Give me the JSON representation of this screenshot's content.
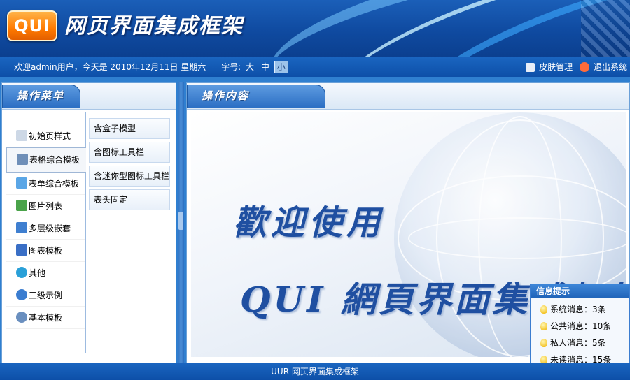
{
  "header": {
    "logo_text": "QUI",
    "title": "网页界面集成框架"
  },
  "statusbar": {
    "welcome": "欢迎admin用户，今天是 2010年12月11日 星期六",
    "font_size_label": "字号:",
    "font_sizes": [
      "大",
      "中",
      "小"
    ],
    "font_size_selected": "小",
    "skin_label": "皮肤管理",
    "logout_label": "退出系统"
  },
  "left_panel": {
    "title": "操作菜单",
    "menu": [
      {
        "label": "初始页样式",
        "icon": "tag-icon"
      },
      {
        "label": "表格综合模板",
        "icon": "table-icon",
        "active": true
      },
      {
        "label": "表单综合模板",
        "icon": "form-icon"
      },
      {
        "label": "图片列表",
        "icon": "image-icon"
      },
      {
        "label": "多层级嵌套",
        "icon": "pages-icon"
      },
      {
        "label": "图表模板",
        "icon": "chart-icon"
      },
      {
        "label": "其他",
        "icon": "globe-icon"
      },
      {
        "label": "三级示例",
        "icon": "info-icon"
      },
      {
        "label": "基本模板",
        "icon": "help-icon"
      }
    ],
    "submenu": [
      "含盒子模型",
      "含图标工具栏",
      "含迷你型图标工具栏",
      "表头固定"
    ]
  },
  "right_panel": {
    "title": "操作内容",
    "welcome_line1": "歡迎使用",
    "welcome_line2": "QUI 網頁界面集成框架"
  },
  "info_box": {
    "title": "信息提示",
    "items": [
      "系统消息：3条",
      "公共消息：10条",
      "私人消息：5条",
      "未读消息：15条"
    ]
  },
  "footer": {
    "text": "UUR 网页界面集成框架"
  },
  "colors": {
    "header_blue": "#0f4aa0",
    "logo_orange": "#ff7a00",
    "accent_text": "#1f4fa1"
  }
}
